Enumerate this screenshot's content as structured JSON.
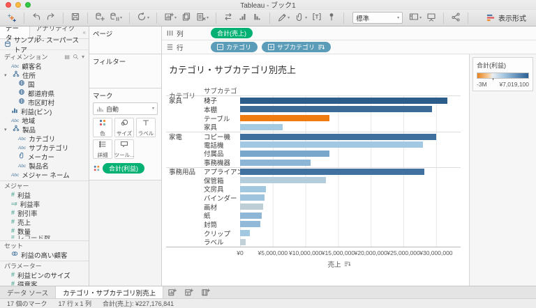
{
  "window": {
    "title": "Tableau - ブック1"
  },
  "icons": {
    "caret_down": "▾",
    "collapse_pane": "«",
    "grid_view": "▤"
  },
  "colors": {
    "pill_green": "#00b173",
    "pill_blue": "#5b9cb8",
    "accent_orange": "#f07b10",
    "accent_blue": "#2a5783"
  },
  "toolbar": {
    "fit_selector": "標準",
    "show_me_label": "表示形式",
    "groups": [
      {
        "icons": [
          {
            "name": "undo"
          },
          {
            "name": "redo"
          }
        ]
      },
      {
        "icons": [
          {
            "name": "save"
          }
        ]
      },
      {
        "icons": [
          {
            "name": "new-data-source"
          },
          {
            "name": "pause-auto-updates",
            "caret": true
          }
        ]
      },
      {
        "icons": [
          {
            "name": "refresh",
            "caret": true
          }
        ]
      },
      {
        "icons": [
          {
            "name": "new-worksheet",
            "caret": true
          },
          {
            "name": "duplicate"
          },
          {
            "name": "clear-sheet",
            "caret": true
          }
        ]
      },
      {
        "icons": [
          {
            "name": "swap-rows-columns"
          },
          {
            "name": "sort-ascending"
          },
          {
            "name": "sort-descending"
          }
        ]
      },
      {
        "icons": [
          {
            "name": "highlight",
            "caret": true
          },
          {
            "name": "group-members",
            "caret": true
          },
          {
            "name": "show-mark-labels"
          },
          {
            "name": "fix-axes"
          }
        ]
      }
    ],
    "groups_right": [
      {
        "icons": [
          {
            "name": "show-hide-cards",
            "caret": true
          },
          {
            "name": "presentation-mode"
          }
        ]
      },
      {
        "icons": [
          {
            "name": "share"
          }
        ]
      }
    ]
  },
  "sidebar": {
    "tabs": [
      {
        "label": "データ",
        "active": true
      },
      {
        "label": "アナリティクス",
        "active": false
      }
    ],
    "data_source": "サンプル - スーパーストア",
    "sections": [
      {
        "title": "ディメンション",
        "header_icons": true,
        "items": [
          {
            "icon": "abc",
            "label": "顧客名",
            "indent": 1
          },
          {
            "icon": "hier",
            "label": "住所",
            "indent": 0,
            "caret": true
          },
          {
            "icon": "globe",
            "label": "国",
            "indent": 2
          },
          {
            "icon": "globe",
            "label": "都道府県",
            "indent": 2
          },
          {
            "icon": "globe",
            "label": "市区町村",
            "indent": 2
          },
          {
            "icon": "bins",
            "label": "利益(ビン)",
            "indent": 1
          },
          {
            "icon": "abc",
            "label": "地域",
            "indent": 1
          },
          {
            "icon": "hier",
            "label": "製品",
            "indent": 0,
            "caret": true
          },
          {
            "icon": "abc",
            "label": "カテゴリ",
            "indent": 2
          },
          {
            "icon": "abc",
            "label": "サブカテゴリ",
            "indent": 2
          },
          {
            "icon": "clip",
            "label": "メーカー",
            "indent": 2
          },
          {
            "icon": "abc",
            "label": "製品名",
            "indent": 2
          },
          {
            "icon": "abc",
            "label": "メジャー ネーム",
            "indent": 1
          }
        ]
      },
      {
        "title": "メジャー",
        "items": [
          {
            "icon": "num",
            "label": "利益",
            "indent": 1
          },
          {
            "icon": "calc",
            "label": "利益率",
            "indent": 1
          },
          {
            "icon": "num",
            "label": "割引率",
            "indent": 1
          },
          {
            "icon": "num",
            "label": "売上",
            "indent": 1
          },
          {
            "icon": "num",
            "label": "数量",
            "indent": 1
          },
          {
            "icon": "num",
            "label": "レコード数",
            "indent": 1,
            "clipped": true
          }
        ]
      },
      {
        "title": "セット",
        "items": [
          {
            "icon": "set",
            "label": "利益の高い顧客",
            "indent": 1
          }
        ]
      },
      {
        "title": "パラメーター",
        "items": [
          {
            "icon": "num",
            "label": "利益ビンのサイズ",
            "indent": 1
          },
          {
            "icon": "num",
            "label": "得意客",
            "indent": 1
          }
        ]
      }
    ]
  },
  "shelves": {
    "pages_label": "ページ",
    "filters_label": "フィルター",
    "columns_label": "列",
    "rows_label": "行",
    "columns_pills": [
      {
        "label": "合計(売上)"
      }
    ],
    "rows_pills": [
      {
        "label": "カテゴリ",
        "prefix": "−"
      },
      {
        "label": "サブカテゴリ",
        "prefix": "+",
        "sort": true
      }
    ]
  },
  "marks": {
    "title": "マーク",
    "mark_type": "自動",
    "buttons": [
      {
        "icon": "color",
        "label": "色"
      },
      {
        "icon": "size",
        "label": "サイズ"
      },
      {
        "icon": "label",
        "label": "ラベル"
      },
      {
        "icon": "detail",
        "label": "詳細"
      },
      {
        "icon": "tooltip",
        "label": "ツール..."
      }
    ],
    "pills": [
      {
        "label": "合計(利益)"
      }
    ]
  },
  "legend": {
    "title": "合計(利益)",
    "min_label": "-3M",
    "max_label": "¥7,019,100",
    "zero_pct": 30,
    "gradient": [
      "#e8821e 0%",
      "#f7d0a1 22%",
      "#e9eef2 30%",
      "#9dc1de 55%",
      "#2a5e93 100%"
    ]
  },
  "chart_data": {
    "type": "bar",
    "title": "カテゴリ・サブカテゴリ別売上",
    "row_headers": [
      "カテゴリ",
      "サブカテゴリ"
    ],
    "xlabel": "売上",
    "color_by": "合計(利益)",
    "x_ticks": [
      "¥0",
      "¥5,000,000",
      "¥10,000,000",
      "¥15,000,000",
      "¥20,000,000",
      "¥25,000,000",
      "¥30,000,000"
    ],
    "x_tick_interval": 5000000,
    "x_max": 33750000,
    "groups": [
      {
        "category": "家具",
        "items": [
          {
            "label": "椅子",
            "value": 31700000,
            "color": "#2b5c8a"
          },
          {
            "label": "本棚",
            "value": 29400000,
            "color": "#3c6a97"
          },
          {
            "label": "テーブル",
            "value": 13700000,
            "color": "#f07b10"
          },
          {
            "label": "家具",
            "value": 6500000,
            "color": "#a5cbe2"
          }
        ]
      },
      {
        "category": "家電",
        "items": [
          {
            "label": "コピー機",
            "value": 30000000,
            "color": "#3f6f9d"
          },
          {
            "label": "電話機",
            "value": 28000000,
            "color": "#a3c9e2"
          },
          {
            "label": "付属品",
            "value": 13700000,
            "color": "#78a7cb"
          },
          {
            "label": "事務機器",
            "value": 10800000,
            "color": "#8db6d6"
          }
        ]
      },
      {
        "category": "事務用品",
        "items": [
          {
            "label": "アプライアンス",
            "value": 28200000,
            "color": "#41719f"
          },
          {
            "label": "保管箱",
            "value": 13100000,
            "color": "#b4cddd"
          },
          {
            "label": "文房具",
            "value": 3900000,
            "color": "#a2c8e0"
          },
          {
            "label": "バインダー",
            "value": 3750000,
            "color": "#9fc5de"
          },
          {
            "label": "画材",
            "value": 3500000,
            "color": "#bdced6"
          },
          {
            "label": "紙",
            "value": 3300000,
            "color": "#8db6d7"
          },
          {
            "label": "封筒",
            "value": 3050000,
            "color": "#92b9d8"
          },
          {
            "label": "クリップ",
            "value": 1500000,
            "color": "#a2c8e1"
          },
          {
            "label": "ラベル",
            "value": 850000,
            "color": "#c2d1d8"
          }
        ]
      }
    ]
  },
  "tabs_bar": {
    "tabs": [
      {
        "label": "データ ソース",
        "active": false
      },
      {
        "label": "カテゴリ・サブカテゴリ別売上",
        "active": true
      }
    ],
    "new_buttons": [
      "new-worksheet-tab",
      "new-dashboard-tab",
      "new-story-tab"
    ]
  },
  "status_bar": {
    "marks": "17 個のマーク",
    "grid": "17 行 x 1 列",
    "total": "合計(売上): ¥227,176,841"
  }
}
